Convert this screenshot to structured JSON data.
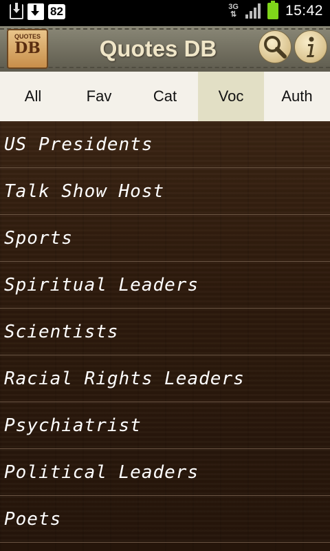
{
  "status_bar": {
    "notification_count": "82",
    "network_type": "3G",
    "time": "15:42"
  },
  "header": {
    "logo_small": "QUOTES",
    "logo_big": "DB",
    "title": "Quotes DB"
  },
  "tabs": [
    {
      "label": "All"
    },
    {
      "label": "Fav"
    },
    {
      "label": "Cat"
    },
    {
      "label": "Voc",
      "active": true
    },
    {
      "label": "Auth"
    }
  ],
  "list": {
    "items": [
      "US Presidents",
      "Talk Show Host",
      "Sports",
      "Spiritual Leaders",
      "Scientists",
      "Racial Rights Leaders",
      "Psychiatrist",
      "Political Leaders",
      "Poets"
    ]
  }
}
